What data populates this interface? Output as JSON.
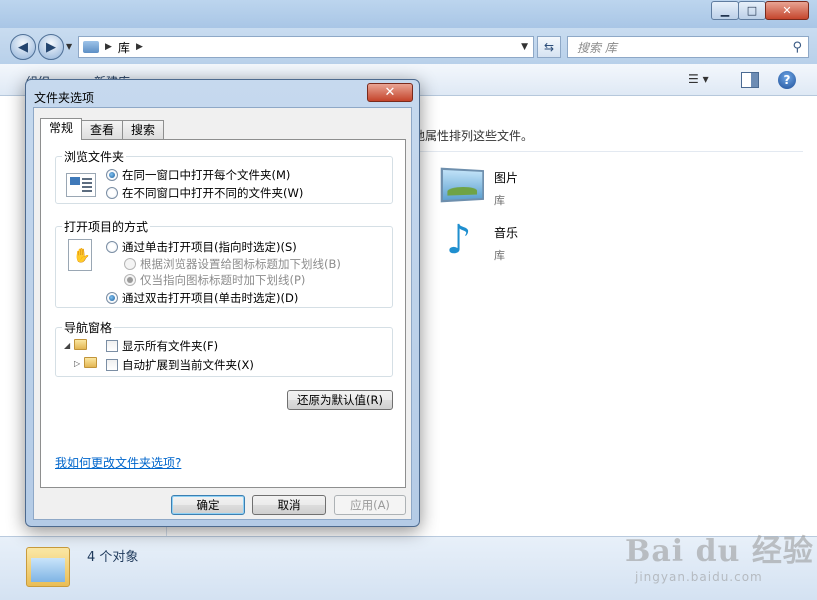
{
  "explorer": {
    "address": {
      "segments": [
        "库"
      ]
    },
    "search": {
      "placeholder": "搜索 库"
    },
    "toolbar": {
      "organize": "组织 ▾",
      "new_library": "新建库"
    },
    "content": {
      "description": "地属性排列这些文件。",
      "items": [
        {
          "name": "图片",
          "type": "库",
          "icon": "pictures-library-icon"
        },
        {
          "name": "音乐",
          "type": "库",
          "icon": "music-library-icon"
        }
      ]
    },
    "statusbar": {
      "text": "4 个对象"
    }
  },
  "dialog": {
    "title": "文件夹选项",
    "tabs": [
      "常规",
      "查看",
      "搜索"
    ],
    "active_tab": "常规",
    "browse_group": {
      "label": "浏览文件夹",
      "options": [
        "在同一窗口中打开每个文件夹(M)",
        "在不同窗口中打开不同的文件夹(W)"
      ],
      "selected": 0
    },
    "click_group": {
      "label": "打开项目的方式",
      "single_click": "通过单击打开项目(指向时选定)(S)",
      "underline_browser": "根据浏览器设置给图标标题加下划线(B)",
      "underline_point": "仅当指向图标标题时加下划线(P)",
      "double_click": "通过双击打开项目(单击时选定)(D)"
    },
    "nav_group": {
      "label": "导航窗格",
      "show_all_folders": "显示所有文件夹(F)",
      "auto_expand": "自动扩展到当前文件夹(X)"
    },
    "restore_defaults": "还原为默认值(R)",
    "help_link": "我如何更改文件夹选项?",
    "buttons": {
      "ok": "确定",
      "cancel": "取消",
      "apply": "应用(A)"
    }
  },
  "watermark": {
    "logo": "Bai du 经验",
    "url": "jingyan.baidu.com"
  },
  "colors": {
    "link": "#0066cc",
    "window_frame": "#b4cbe6",
    "close_red": "#c4442b"
  }
}
